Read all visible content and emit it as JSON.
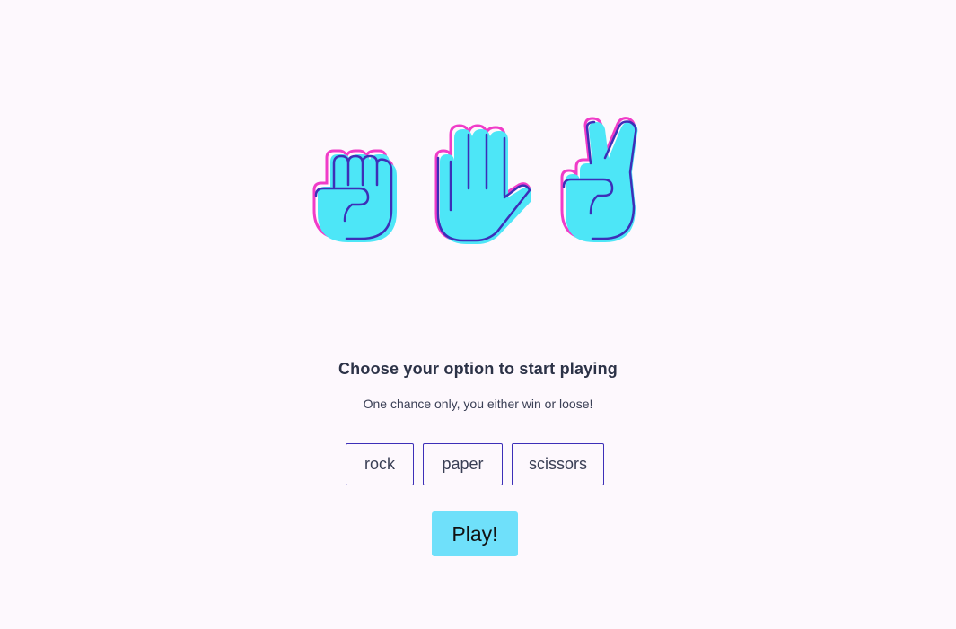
{
  "hero": {
    "icons": [
      "rock-hand-icon",
      "paper-hand-icon",
      "scissors-hand-icon"
    ],
    "colors": {
      "fill": "#4de6f7",
      "outline": "#f03cc8",
      "line": "#3d2fb8"
    }
  },
  "content": {
    "title": "Choose your option to start playing",
    "subtitle": "One chance only, you either win or loose!"
  },
  "options": [
    {
      "label": "rock"
    },
    {
      "label": "paper"
    },
    {
      "label": "scissors"
    }
  ],
  "play": {
    "label": "Play!",
    "color": "#6fe0fa"
  },
  "page": {
    "background": "#fdf8fd"
  }
}
